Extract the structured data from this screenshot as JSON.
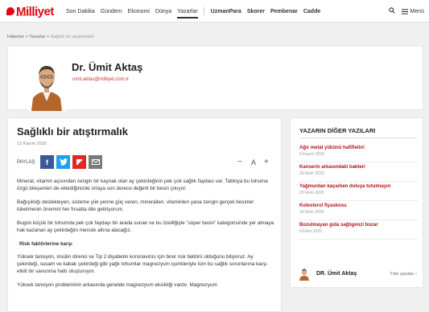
{
  "brand": {
    "logo": "Milliyet",
    "tagline": "BAĞIMSIZ GÜNLÜK"
  },
  "nav": {
    "items": [
      "Son Dakika",
      "Gündem",
      "Ekonomi",
      "Dünya",
      "Yazarlar"
    ],
    "active": "Yazarlar",
    "partners": [
      "UzmanPara",
      "Skorer",
      "Pembenar",
      "Cadde"
    ],
    "menu_label": "Menü"
  },
  "breadcrumb": {
    "home": "Haberler",
    "section": "Yazarlar",
    "current": "Sağlıklı bir atıştırmalık"
  },
  "author": {
    "name": "Dr. Ümit Aktaş",
    "email": "umit.aktas@milliyet.com.tr"
  },
  "article": {
    "title": "Sağlıklı bir atıştırmalık",
    "date": "13 Kasım 2020",
    "share_label": "PAYLAŞ",
    "font_minus": "−",
    "font_label": "A",
    "font_plus": "+",
    "paragraphs": [
      "Mineral, vitamin açısından zengin bir kaynak olan ay çekirdeğinin pek çok sağlık faydası var. Tabloya bu tohuma özgü bileşenleri de eklediğinizde ortaya son derece değerli bir besin çıkıyor.",
      "Bağışıklığı destekleyen, sisteme yük yerine güç veren, mineralleri, vitaminleri yana zengin gerçek besinler tüketmenin önemini her fırsatta dile getiriyorum.",
      "Bugün küçük bir tohumda pek çok faydayı bir arada sunan ve bu özelliğiyle \"süper besin\" kategorisinde yer almaya hak kazanan ay çekirdeğini mercek altına alacağız."
    ],
    "subheading": "Risk faktörlerine  karşı",
    "paragraphs2": [
      "Yüksek tansiyon, insülin direnci ve Tip 2 diyabetin koronavirüs için birer risk faktörü olduğunu biliyoruz. Ay çekirdeği, susam ve kabak çekirdeği gibi yağlı tohumlar magnezyum içerikleriyle tüm bu sağlık sorunlarına karşı etkili bir savunma hattı oluşturuyor.",
      "Yüksek tansiyon probleminin arkasında genelde magnezyum eksikliği vardır. Magnezyum"
    ]
  },
  "sidebar": {
    "heading": "YAZARIN DİĞER YAZILARI",
    "items": [
      {
        "title": "Ağır metal yükünü hafifletin!",
        "date": "6 Kasım 2020"
      },
      {
        "title": "Kanserin arkasındaki bakteri",
        "date": "30 Ekim 2020"
      },
      {
        "title": "Yağmurdan kaçarken doluya tutulmayın",
        "date": "23 Ekim 2020"
      },
      {
        "title": "Kolesterol fiyaskosu",
        "date": "16 Ekim 2020"
      },
      {
        "title": "Bozulmayan gıda sağlıgınızi bozar",
        "date": "9 Ekim 2020"
      }
    ],
    "footer_name": "DR. Ümit Aktaş",
    "footer_link": "Tüm yazıları"
  },
  "colors": {
    "brand": "#e30613",
    "link": "#b3121a",
    "facebook": "#3b5998",
    "twitter": "#1da1f2",
    "flipboard": "#e12828",
    "mail": "#7a7a7a"
  }
}
